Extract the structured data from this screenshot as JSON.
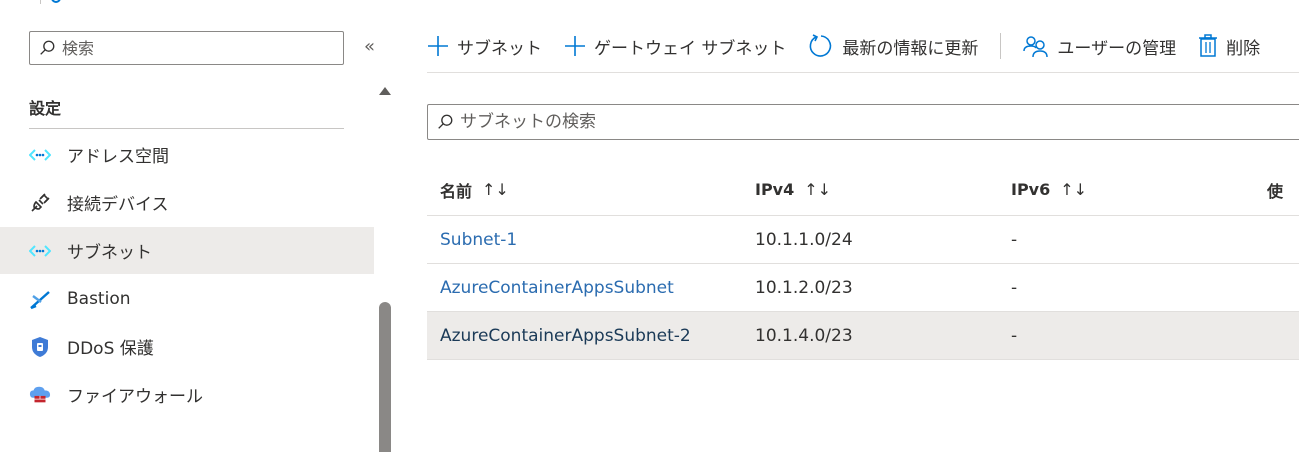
{
  "nav": {
    "search_placeholder": "検索",
    "collapse_icon": "«",
    "section_title": "設定",
    "items": [
      {
        "label": "アドレス空間",
        "icon": "address-space-icon"
      },
      {
        "label": "接続デバイス",
        "icon": "plug-icon"
      },
      {
        "label": "サブネット",
        "icon": "subnet-icon",
        "active": true
      },
      {
        "label": "Bastion",
        "icon": "bastion-icon"
      },
      {
        "label": "DDoS 保護",
        "icon": "shield-icon"
      },
      {
        "label": "ファイアウォール",
        "icon": "firewall-icon"
      }
    ]
  },
  "toolbar": {
    "add_subnet": "サブネット",
    "add_gateway_subnet": "ゲートウェイ サブネット",
    "refresh": "最新の情報に更新",
    "manage_users": "ユーザーの管理",
    "delete": "削除"
  },
  "subnet_search": {
    "placeholder": "サブネットの検索"
  },
  "table": {
    "columns": [
      "名前",
      "IPv4",
      "IPv6",
      "使"
    ],
    "sort_glyph": "↑↓",
    "rows": [
      {
        "name": "Subnet-1",
        "ipv4": "10.1.1.0/24",
        "ipv6": "-"
      },
      {
        "name": "AzureContainerAppsSubnet",
        "ipv4": "10.1.2.0/23",
        "ipv6": "-"
      },
      {
        "name": "AzureContainerAppsSubnet-2",
        "ipv4": "10.1.4.0/23",
        "ipv6": "-",
        "selected": true
      }
    ]
  },
  "colors": {
    "accent": "#0078d4",
    "selected_bg": "#edebe9",
    "text": "#323130"
  }
}
